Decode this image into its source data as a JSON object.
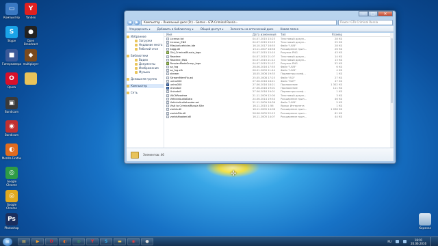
{
  "desktop_icons": [
    {
      "label": "Компьютер",
      "icon": "computer-icon",
      "color": "#3a78c2",
      "glyph": "▭"
    },
    {
      "label": "Yandex",
      "icon": "yandex-icon",
      "color": "#e02020",
      "glyph": "Y"
    },
    {
      "label": "Skype",
      "icon": "skype-icon",
      "color": "#1aa3e8",
      "glyph": "S"
    },
    {
      "label": "Open Broadcast",
      "icon": "obs-icon",
      "color": "#222222",
      "glyph": "●"
    },
    {
      "label": "Гиперкамера",
      "icon": "camera-icon",
      "color": "#3b5998",
      "glyph": "■"
    },
    {
      "label": "multiplayer",
      "icon": "multiplayer-icon",
      "color": "#7a4a1e",
      "glyph": "◆"
    },
    {
      "label": "Opera",
      "icon": "opera-icon",
      "color": "#d8102a",
      "glyph": "O"
    },
    {
      "label": "",
      "icon": "folder-icon",
      "color": "#e8c35a",
      "glyph": ""
    },
    {
      "label": "Bandicam",
      "icon": "bandicam-icon",
      "color": "#3a3a3a",
      "glyph": "▣"
    },
    {
      "label": "Bandicam",
      "icon": "bandicam-icon",
      "color": "#c03030",
      "glyph": "◉"
    },
    {
      "label": "Mozilla Firefox",
      "icon": "firefox-icon",
      "color": "#e06b1f",
      "glyph": "◐"
    },
    {
      "label": "Google Chrome",
      "icon": "chrome-icon",
      "color": "#2e9b46",
      "glyph": "◎"
    },
    {
      "label": "Google Chrome",
      "icon": "chrome-icon",
      "color": "#e0a91f",
      "glyph": "◎"
    },
    {
      "label": "Photoshop",
      "icon": "photoshop-icon",
      "color": "#1b2f5e",
      "glyph": "Ps"
    }
  ],
  "recycle_bin": {
    "label": "Корзина",
    "icon": "recycle-bin-icon"
  },
  "window": {
    "address": "Компьютер › Локальный диск (D:) › Games › GTA Criminal Russia ›",
    "search_placeholder": "Поиск: GTA Criminal Russia",
    "toolbar": [
      "Упорядочить ▾",
      "Добавить в библиотеку ▾",
      "Общий доступ ▾",
      "Записать на оптический диск",
      "Новая папка"
    ],
    "nav": {
      "favorites": "Избранное",
      "favorites_items": [
        "Загрузки",
        "Недавние места",
        "Рабочий стол"
      ],
      "libraries": "Библиотеки",
      "libraries_items": [
        "Видео",
        "Документы",
        "Изображения",
        "Музыка"
      ],
      "homegroup": "Домашняя группа",
      "computer": "Компьютер",
      "network": "Сеть"
    },
    "columns": {
      "name": "Имя",
      "date": "Дата изменения",
      "type": "Тип",
      "size": "Размер"
    },
    "files": [
      {
        "name": "License.txt",
        "date": "04.07.2015 15:23",
        "type": "Текстовый докум...",
        "size": "28 КБ",
        "kind": "doc"
      },
      {
        "name": "License_ENG",
        "date": "04.07.2015 15:23",
        "type": "Текстовый докум...",
        "size": "25 КБ",
        "kind": "doc"
      },
      {
        "name": "Mission\\vehicles.ide",
        "date": "16.10.2017 16:55",
        "type": "Файл \"UUB\"",
        "size": "28 КБ",
        "kind": "doc"
      },
      {
        "name": "kagg.dll",
        "date": "13.11.2007 18:58",
        "type": "Расширение прил...",
        "size": "26 КБ",
        "kind": "doc"
      },
      {
        "name": "Old_CriminalRussia_logo",
        "date": "04.07.2015 15:10",
        "type": "Рисунок PNG",
        "size": "43 КБ",
        "kind": "img"
      },
      {
        "name": "Readme",
        "date": "04.07.2015 21:07",
        "type": "Текстовый докум...",
        "size": "14 КБ",
        "kind": "doc"
      },
      {
        "name": "Readme_ENG",
        "date": "04.07.2015 21:12",
        "type": "Текстовый докум...",
        "size": "13 КБ",
        "kind": "doc"
      },
      {
        "name": "RussianModsGroup_logo",
        "date": "04.07.2015 21:27",
        "type": "Рисунок PNG",
        "size": "52 КБ",
        "kind": "img"
      },
      {
        "name": "sa_fxg",
        "date": "28.06.2016 17:55",
        "type": "Файл \"UUB\"",
        "size": "6 КБ",
        "kind": "doc"
      },
      {
        "name": "sa_fxg.sfh",
        "date": "06.01.2009 11:44",
        "type": "Файл \"UUB\"",
        "size": "4 КБ",
        "kind": "doc"
      },
      {
        "name": "stream",
        "date": "18.05.2006 19:33",
        "type": "Параметры конф...",
        "size": "1 КБ",
        "kind": "doc"
      },
      {
        "name": "StreamMemFix.asi",
        "date": "25.05.2008 17:23",
        "type": "Файл \"ASI\"",
        "size": "27 КБ",
        "kind": "doc"
      },
      {
        "name": "unins000",
        "date": "27.06.2016 18:21",
        "type": "Файл \"DAT\"",
        "size": "47 КБ",
        "kind": "doc"
      },
      {
        "name": "unins000",
        "date": "27.06.2016 18:21",
        "type": "Приложение",
        "size": "1 302 КБ",
        "kind": "exe"
      },
      {
        "name": "Uninstall",
        "date": "27.06.2016 19:01",
        "type": "Приложение",
        "size": "111 КБ",
        "kind": "exe"
      },
      {
        "name": "Uninstall",
        "date": "27.06.2016 19:01",
        "type": "Параметры конф...",
        "size": "1 КБ",
        "kind": "doc"
      },
      {
        "name": "VAChReadme",
        "date": "21.11.2009 12:00",
        "type": "Текстовый докум...",
        "size": "3 КБ",
        "kind": "doc"
      },
      {
        "name": "VehicleAudioData",
        "date": "24.06.2014 19:54",
        "type": "Расширение прил...",
        "size": "46 КБ",
        "kind": "doc"
      },
      {
        "name": "VehicleAudioLoader.asi",
        "date": "21.11.2009 16:36",
        "type": "Файл \"UUB\"",
        "size": "5 КБ",
        "kind": "doc"
      },
      {
        "name": "Visit to CriminalRussia Site",
        "date": "16.11.2015 1:56",
        "type": "Ярлык Интернета",
        "size": "1 КБ",
        "kind": "doc"
      },
      {
        "name": "vorbis.dll",
        "date": "16.11.2005 14:06",
        "type": "Расширение прил...",
        "size": "1 038 КБ",
        "kind": "doc"
      },
      {
        "name": "vorbisFile.dll",
        "date": "26.06.2005 22:13",
        "type": "Расширение прил...",
        "size": "61 КБ",
        "kind": "doc"
      },
      {
        "name": "vorbisHooked.dll",
        "date": "16.11.2005 14:07",
        "type": "Расширение прил...",
        "size": "44 КБ",
        "kind": "doc"
      }
    ],
    "status": "Элементов: 46"
  },
  "taskbar": {
    "items": [
      {
        "icon": "explorer-icon",
        "glyph": "▤",
        "color": "#e8c35a"
      },
      {
        "icon": "media-player-icon",
        "glyph": "▶",
        "color": "#f0a030"
      },
      {
        "icon": "opera-icon",
        "glyph": "O",
        "color": "#e02030"
      },
      {
        "icon": "firefox-icon",
        "glyph": "◐",
        "color": "#f07020"
      },
      {
        "icon": "chrome-icon",
        "glyph": "◎",
        "color": "#40b050"
      },
      {
        "icon": "yandex-icon",
        "glyph": "Y",
        "color": "#ff3030"
      },
      {
        "icon": "skype-icon",
        "glyph": "S",
        "color": "#30b0f0"
      },
      {
        "icon": "folder-icon",
        "glyph": "▬",
        "color": "#e8c35a"
      },
      {
        "icon": "bandicam-icon",
        "glyph": "◉",
        "color": "#e04040"
      },
      {
        "icon": "obs-icon",
        "glyph": "●",
        "color": "#dddddd"
      }
    ],
    "lang": "RU",
    "time": "18:01",
    "date": "20.06.2016"
  }
}
